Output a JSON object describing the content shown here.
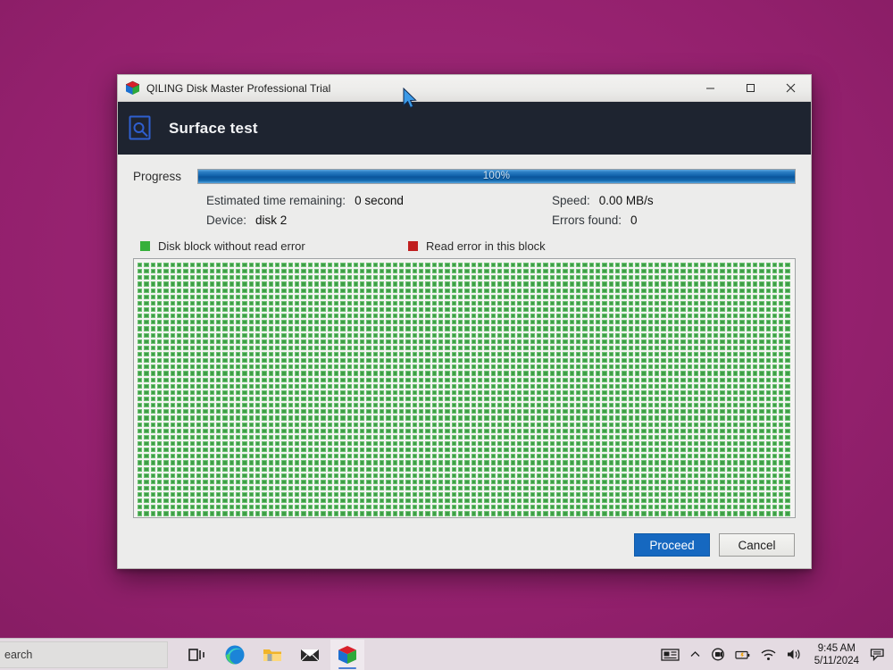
{
  "desktop": {
    "background_color": "#93206d"
  },
  "window": {
    "titlebar": {
      "app_icon": "cube-icon",
      "title": "QILING Disk Master Professional Trial",
      "minimize_label": "Minimize",
      "maximize_label": "Maximize",
      "close_label": "Close"
    },
    "header": {
      "icon": "surface-scan-icon",
      "title": "Surface test",
      "background_color": "#1e2430",
      "icon_color": "#2f5fd0"
    },
    "progress": {
      "label": "Progress",
      "percent_text": "100%",
      "percent_value": 100,
      "fill_color": "#0e5fa8"
    },
    "stats": [
      {
        "key": "Estimated time remaining:",
        "value": "0 second",
        "column": "left"
      },
      {
        "key": "Speed:",
        "value": "0.00 MB/s",
        "column": "right"
      },
      {
        "key": "Device:",
        "value": "disk 2",
        "column": "left"
      },
      {
        "key": "Errors found:",
        "value": "0",
        "column": "right"
      }
    ],
    "legend": [
      {
        "label": "Disk block without read error",
        "color": "#35b03a",
        "swatch": "green"
      },
      {
        "label": "Read error in this block",
        "color": "#c01f1f",
        "swatch": "red"
      }
    ],
    "block_map": {
      "columns": 100,
      "rows": 40,
      "total_blocks": 4000,
      "error_blocks": 0,
      "good_color": "#3f9e47",
      "error_color": "#bc2020",
      "background_color": "#f4f4f2"
    },
    "buttons": {
      "proceed": "Proceed",
      "cancel": "Cancel",
      "proceed_color": "#1668c0"
    }
  },
  "taskbar": {
    "search_placeholder": "earch",
    "items": [
      {
        "name": "task-view",
        "icon": "task-view-icon"
      },
      {
        "name": "edge",
        "icon": "edge-browser-icon"
      },
      {
        "name": "file-explorer",
        "icon": "folder-icon"
      },
      {
        "name": "mail",
        "icon": "envelope-icon"
      },
      {
        "name": "qiling-disk-master",
        "icon": "cube-icon",
        "active": true
      }
    ],
    "tray": {
      "news": "news-icon",
      "chevron": "chevron-up-icon",
      "device": "device-icon",
      "battery": "battery-warning-icon",
      "network": "wifi-icon",
      "volume": "speaker-icon",
      "time": "9:45 AM",
      "date": "5/11/2024",
      "notifications": "notification-icon"
    }
  }
}
